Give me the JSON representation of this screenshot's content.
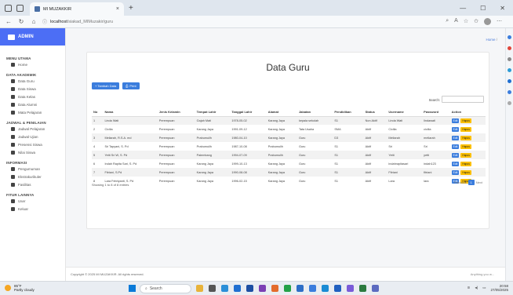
{
  "browser": {
    "tab_title": "MI MUZAKKIR",
    "tab_close": "×",
    "new_tab": "+",
    "url_host": "localhost",
    "url_path": "/siakad_MIMuzakir/guru",
    "window_controls": [
      "—",
      "☐",
      "✕"
    ]
  },
  "app": {
    "brand": "ADMIN",
    "breadcrumb": {
      "home": "Home",
      "sep": "/"
    },
    "page_title": "Data Guru",
    "footer": "Copyright © 2025 MI MUZAKKIR. All rights reserved.",
    "footer_right": "Anything you w..."
  },
  "sidebar": {
    "sections": [
      {
        "title": "MENU UTAMA",
        "items": [
          "Home"
        ]
      },
      {
        "title": "DATA AKADEMIK",
        "items": [
          "Data Guru",
          "Data Siswa",
          "Data Kelas",
          "Data Alumni",
          "Mata Pelajaran"
        ]
      },
      {
        "title": "JADWAL & PENILAIAN",
        "items": [
          "Jadwal Pelajaran",
          "Jadwal Ujian",
          "Presensi Siswa",
          "Nilai Siswa"
        ]
      },
      {
        "title": "INFORMASI",
        "items": [
          "Pengumuman",
          "Ekstrakurikuler",
          "Fasilitas"
        ]
      },
      {
        "title": "FITUR LAINNYA",
        "items": [
          "User",
          "Keluar"
        ]
      }
    ]
  },
  "toolbar": {
    "add_label": "+ Tambah Data",
    "print_label": "Print",
    "search_label": "Search:",
    "search_value": ""
  },
  "table": {
    "columns": [
      "No",
      "Nama",
      "Jenis Kelamin",
      "Tempat Lahir",
      "Tanggal Lahir",
      "Alamat",
      "Jabatan",
      "Pendidikan",
      "Status",
      "Username",
      "Password",
      "Action"
    ],
    "rows": [
      [
        "1",
        "Linda Wati",
        "Perempuan",
        "Gajah Mati",
        "1978-05-02",
        "Karang Jaya",
        "kepala sekolah",
        "S1",
        "Non Aktif",
        "Linda Wati",
        "lindawati"
      ],
      [
        "2",
        "Cicilia",
        "Perempuan",
        "Karang Jaya",
        "1991-09-12",
        "Karang Jaya",
        "Tata Usaha",
        "SMA",
        "Aktif",
        "Cicilia",
        "cicilia"
      ],
      [
        "3",
        "Meliarah, R.S.A. md",
        "Perempuan",
        "Prabumulih",
        "1980-04-10",
        "Karang Jaya",
        "Guru",
        "D3",
        "Aktif",
        "Meliarah",
        "meliarah"
      ],
      [
        "4",
        "Sri Tapyani, S. Pd",
        "Perempuan",
        "Prabumulih",
        "1987-10-08",
        "Prabumulih",
        "Guru",
        "S1",
        "Aktif",
        "Sri",
        "Sri"
      ],
      [
        "5",
        "Yetti Sri W, S. Pd",
        "Perempuan",
        "Palembang",
        "1994-07-09",
        "Prabumulih",
        "Guru",
        "S1",
        "Aktif",
        "Yetti",
        "yetti"
      ],
      [
        "6",
        "Indah Rapita Sari, S. Pd",
        "Perempuan",
        "Karang Jaya",
        "1999-10-13",
        "Karang Jaya",
        "Guru",
        "S1",
        "Aktif",
        "indahrapitasari",
        "indah123"
      ],
      [
        "7",
        "Fitriani, S.Pd",
        "Perempuan",
        "Karang Jaya",
        "1990-08-08",
        "Karang Jaya",
        "Guru",
        "S1",
        "Aktif",
        "Fitriani",
        "fitriani"
      ],
      [
        "8",
        "Lara Febriyanti, S. Pd",
        "Perempuan",
        "Karang Jaya",
        "1996-02-15",
        "Karang Jaya",
        "Guru",
        "S1",
        "Aktif",
        "Lara",
        "lara"
      ]
    ],
    "edit_label": "Edit",
    "delete_label": "Hapus"
  },
  "pagination": {
    "info": "Showing 1 to 8 of 8 entries",
    "previous": "Previous",
    "current": "1",
    "next": "Next"
  },
  "taskbar": {
    "temp": "85°F",
    "weather": "Partly cloudy",
    "search": "Search",
    "time": "20:58",
    "date": "27/05/2025"
  },
  "colors": {
    "accent": "#3b7ddd",
    "brand": "#4c6ef5",
    "delete": "#fcc000"
  }
}
